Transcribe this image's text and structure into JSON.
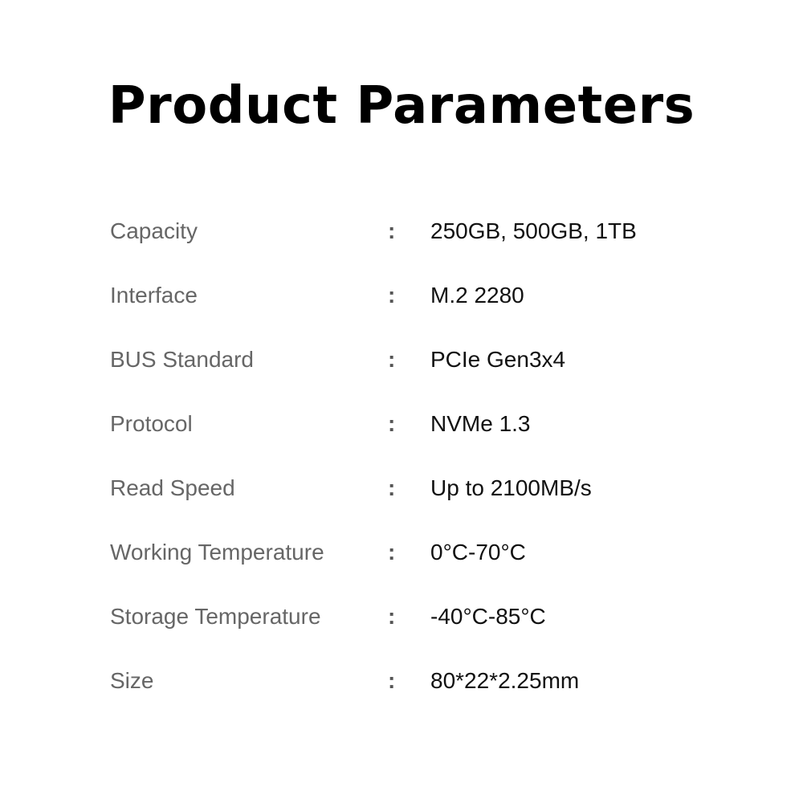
{
  "title": "Product Parameters",
  "separator": ":",
  "rows": [
    {
      "label": "Capacity",
      "value": "250GB, 500GB, 1TB"
    },
    {
      "label": "Interface",
      "value": "M.2 2280"
    },
    {
      "label": "BUS Standard",
      "value": "PCIe Gen3x4"
    },
    {
      "label": "Protocol",
      "value": "NVMe 1.3"
    },
    {
      "label": "Read Speed",
      "value": "Up to 2100MB/s"
    },
    {
      "label": "Working Temperature",
      "value": "0°C-70°C"
    },
    {
      "label": "Storage Temperature",
      "value": "-40°C-85°C"
    },
    {
      "label": "Size",
      "value": "80*22*2.25mm"
    }
  ]
}
